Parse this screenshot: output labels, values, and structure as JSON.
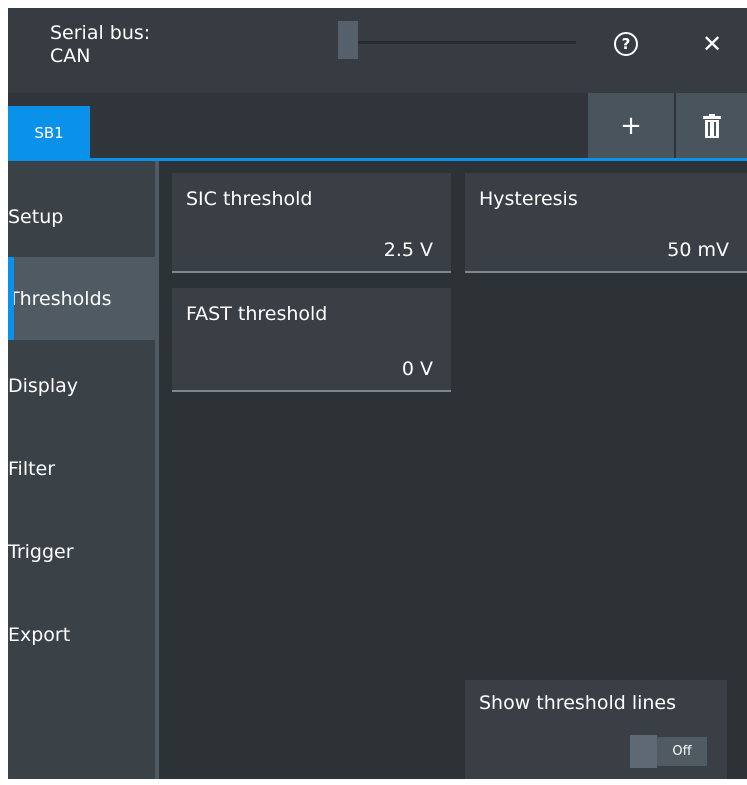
{
  "window": {
    "title_line1": "Serial bus:",
    "title_line2": "CAN"
  },
  "tabs": [
    {
      "label": "SB1",
      "active": true
    }
  ],
  "toolbar": {
    "add_label": "+",
    "help_icon": "help-circle-icon",
    "close_icon": "close-icon",
    "delete_icon": "trash-icon"
  },
  "sidebar": {
    "items": [
      {
        "label": "Setup",
        "active": false
      },
      {
        "label": "Thresholds",
        "active": true
      },
      {
        "label": "Display",
        "active": false
      },
      {
        "label": "Filter",
        "active": false
      },
      {
        "label": "Trigger",
        "active": false
      },
      {
        "label": "Export",
        "active": false
      }
    ]
  },
  "fields": {
    "sic_threshold": {
      "label": "SIC threshold",
      "value": "2.5 V"
    },
    "hysteresis": {
      "label": "Hysteresis",
      "value": "50 mV"
    },
    "fast_threshold": {
      "label": "FAST threshold",
      "value": "0 V"
    }
  },
  "show_threshold_lines": {
    "label": "Show threshold lines",
    "state": "Off"
  },
  "colors": {
    "accent": "#0a91ea",
    "background": "#2d3236",
    "panel": "#393f45"
  }
}
